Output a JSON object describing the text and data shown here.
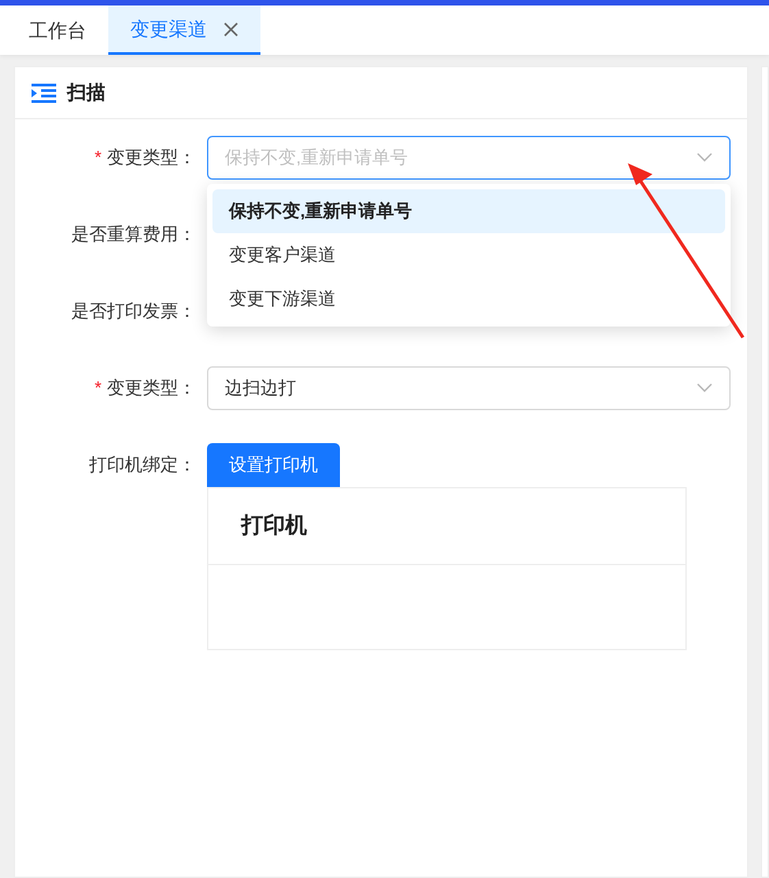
{
  "tabs": [
    {
      "label": "工作台",
      "selected": false,
      "closable": false
    },
    {
      "label": "变更渠道",
      "selected": true,
      "closable": true
    }
  ],
  "panel": {
    "title": "扫描",
    "rows": [
      {
        "kind": "select",
        "mark": "*",
        "label": "变更类型：",
        "placeholder": "保持不变,重新申请单号",
        "focused": true
      },
      {
        "kind": "covered",
        "label": "是否重算费用："
      },
      {
        "kind": "covered",
        "label": "是否打印发票："
      },
      {
        "kind": "select",
        "mark": "*",
        "label": "变更类型：",
        "value": "边扫边打",
        "focused": false
      },
      {
        "kind": "button",
        "label": "打印机绑定：",
        "button": "设置打印机",
        "table_header": "打印机"
      }
    ]
  },
  "dropdown": {
    "options": [
      {
        "label": "保持不变,重新申请单号",
        "selected": true
      },
      {
        "label": "变更客户渠道",
        "selected": false
      },
      {
        "label": "变更下游渠道",
        "selected": false
      }
    ]
  }
}
